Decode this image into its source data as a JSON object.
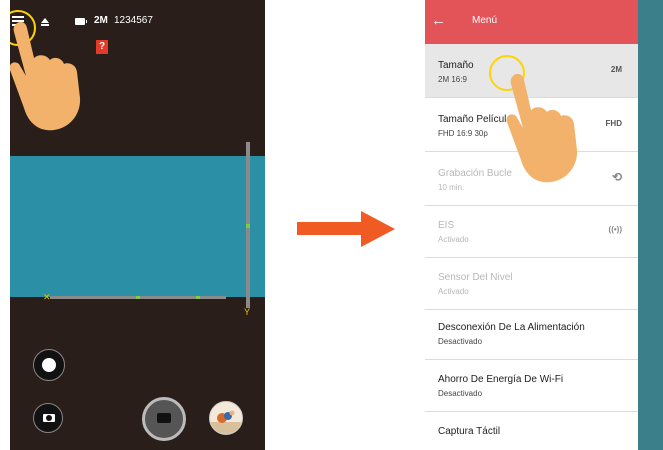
{
  "left_screen": {
    "status": {
      "resolution": "2M",
      "counter": "1234567"
    },
    "warning_badge": "?"
  },
  "right_screen": {
    "header": {
      "back_glyph": "←",
      "title": "Menú"
    },
    "items": [
      {
        "title": "Tamaño",
        "subtitle": "2M 16:9",
        "icon_text": "2M",
        "icon": "size-icon",
        "state": "selected"
      },
      {
        "title": "Tamaño Película",
        "subtitle": "FHD 16:9 30p",
        "icon_text": "FHD",
        "icon": "movie-size-icon",
        "state": "enabled"
      },
      {
        "title": "Grabación Bucle",
        "subtitle": "10 min.",
        "icon_text": "⟲",
        "icon": "loop-icon",
        "state": "disabled"
      },
      {
        "title": "EIS",
        "subtitle": "Activado",
        "icon_text": "((•))",
        "icon": "eis-icon",
        "state": "disabled"
      },
      {
        "title": "Sensor Del Nivel",
        "subtitle": "Activado",
        "icon_text": "",
        "icon": "",
        "state": "disabled"
      },
      {
        "title": "Desconexión De La Alimentación",
        "subtitle": "Desactivado",
        "icon_text": "",
        "icon": "",
        "state": "enabled"
      },
      {
        "title": "Ahorro De Energía De Wi-Fi",
        "subtitle": "Desactivado",
        "icon_text": "",
        "icon": "",
        "state": "enabled"
      },
      {
        "title": "Captura Táctil",
        "subtitle": "",
        "icon_text": "",
        "icon": "",
        "state": "enabled"
      }
    ]
  },
  "colors": {
    "header": "#e35459",
    "arrow": "#f05a23",
    "highlight": "#ffd400",
    "sky": "#2b8fa6"
  }
}
